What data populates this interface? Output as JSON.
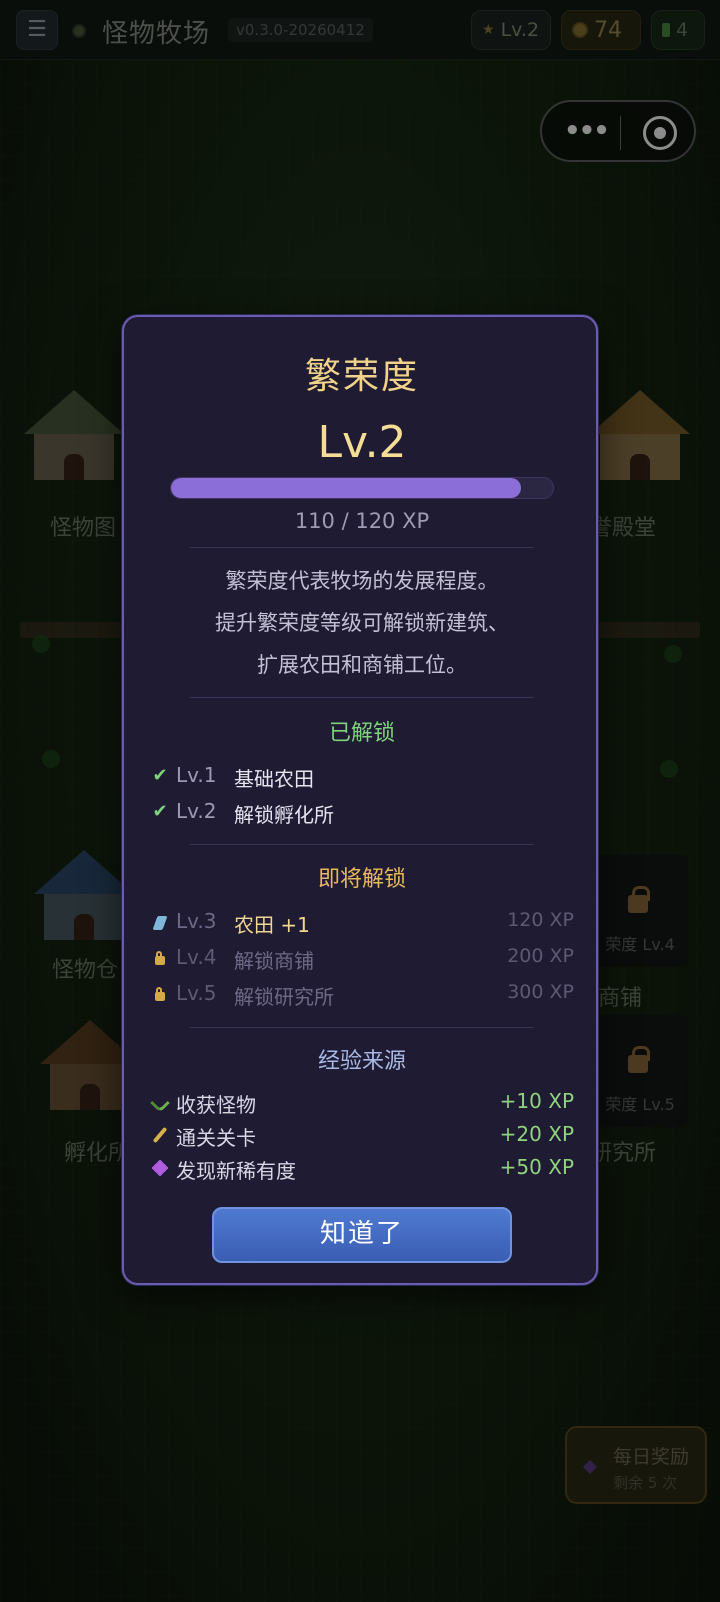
{
  "topbar": {
    "menu_icon": "menu-icon",
    "game_title": "怪物牧场",
    "version": "v0.3.0-20260412",
    "level_badge": "Lv.2",
    "coins": "74",
    "energy": "4"
  },
  "buildings": {
    "left_top": "怪物图",
    "right_top": "誉殿堂",
    "left_mid": "怪物仓",
    "right_mid": "商铺",
    "right_mid_lock": "荣度 Lv.4",
    "left_bottom": "孵化所",
    "right_bottom": "研究所",
    "right_bottom_lock": "荣度 Lv.5"
  },
  "daily_reward": {
    "title": "每日奖励",
    "remaining": "剩余 5 次"
  },
  "modal": {
    "title": "繁荣度",
    "level": "Lv.2",
    "xp_current": 110,
    "xp_max": 120,
    "xp_text": "110 / 120 XP",
    "desc_line1": "繁荣度代表牧场的发展程度。",
    "desc_line2": "提升繁荣度等级可解锁新建筑、",
    "desc_line3": "扩展农田和商铺工位。",
    "unlocked_title": "已解锁",
    "unlocked": [
      {
        "level": "Lv.1",
        "name": "基础农田"
      },
      {
        "level": "Lv.2",
        "name": "解锁孵化所"
      }
    ],
    "upcoming_title": "即将解锁",
    "upcoming": [
      {
        "level": "Lv.3",
        "name": "农田 +1",
        "xp": "120 XP"
      },
      {
        "level": "Lv.4",
        "name": "解锁商铺",
        "xp": "200 XP"
      },
      {
        "level": "Lv.5",
        "name": "解锁研究所",
        "xp": "300 XP"
      }
    ],
    "source_title": "经验来源",
    "sources": [
      {
        "name": "收获怪物",
        "value": "+10 XP"
      },
      {
        "name": "通关关卡",
        "value": "+20 XP"
      },
      {
        "name": "发现新稀有度",
        "value": "+50 XP"
      }
    ],
    "ok_label": "知道了"
  },
  "colors": {
    "modal_bg": "#1f1b33",
    "modal_border": "#6b5cb3",
    "accent_gold": "#f1d38a",
    "xp_fill": "#8b6ed8",
    "unlocked_green": "#7ed47c",
    "upcoming_orange": "#e8b85c",
    "button_blue": "#3a5eb4"
  }
}
